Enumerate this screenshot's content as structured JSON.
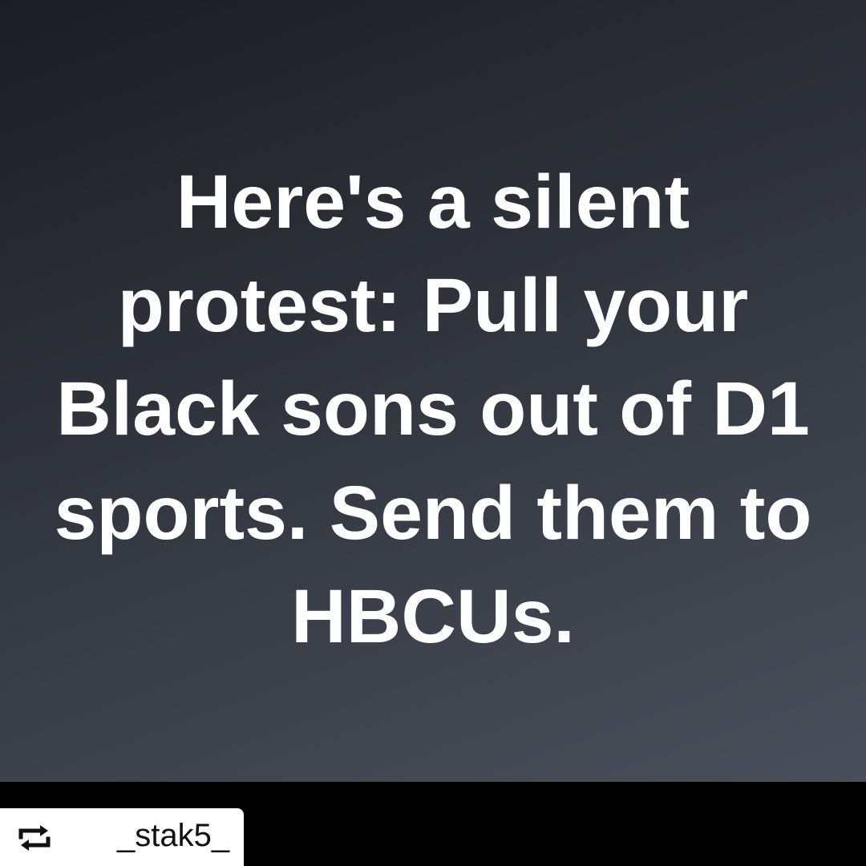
{
  "post": {
    "lines": [
      "Here's a silent",
      "protest: Pull your",
      "Black sons out of D1",
      "sports. Send them to",
      "HBCUs."
    ],
    "text_color": "#ffffff",
    "background_gradient": [
      "#1b1d22",
      "#4a4f5b"
    ]
  },
  "repost": {
    "icon": "repost-icon",
    "username": "_stak5_"
  }
}
